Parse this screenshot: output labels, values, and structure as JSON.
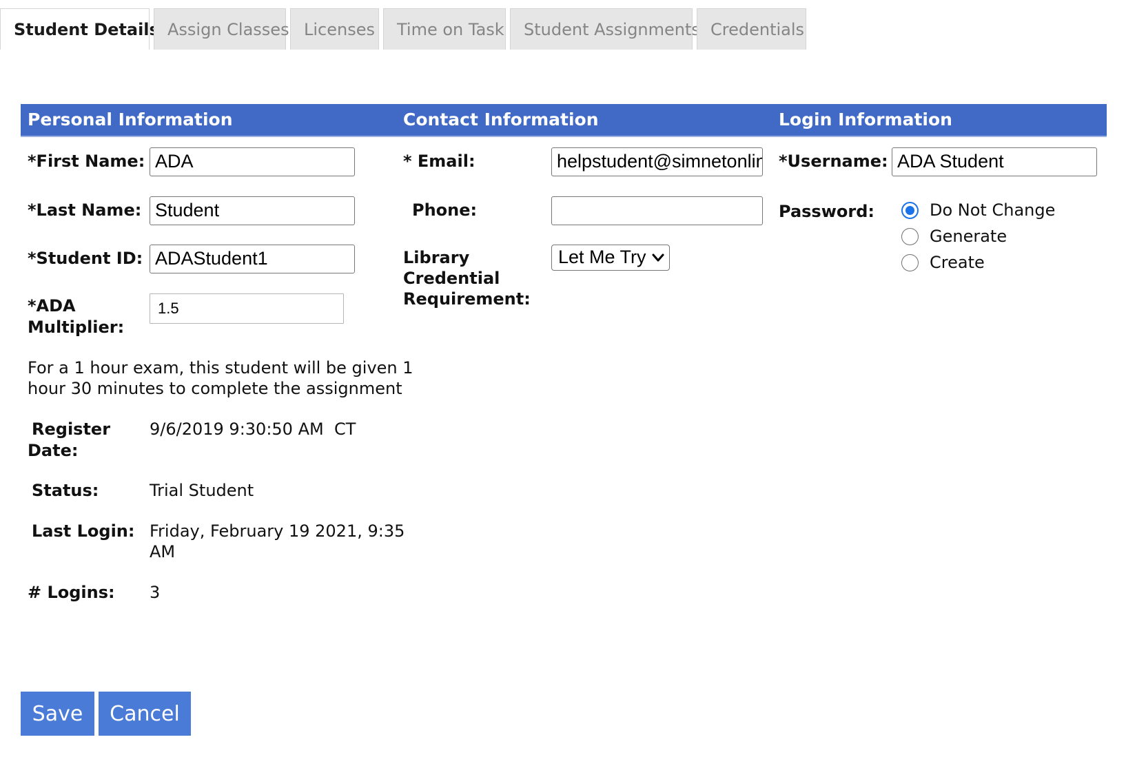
{
  "tabs": [
    "Student Details",
    "Assign Classes",
    "Licenses",
    "Time on Task",
    "Student Assignments",
    "Credentials"
  ],
  "sections": {
    "personal": "Personal Information",
    "contact": "Contact Information",
    "login": "Login Information"
  },
  "personal": {
    "first_name_label": "*First Name:",
    "first_name": "ADA",
    "last_name_label": "*Last Name:",
    "last_name": "Student",
    "student_id_label": "*Student ID:",
    "student_id": "ADAStudent1",
    "ada_label_1": "*ADA",
    "ada_label_2": "Multiplier:",
    "ada_multiplier": "1.5",
    "note_line1": "For a 1 hour exam, this student will be given 1",
    "note_line2": "hour 30 minutes to complete the assignment",
    "register_label_1": "Register",
    "register_label_2": "Date:",
    "register_date": "9/6/2019 9:30:50 AM  CT",
    "status_label": "Status:",
    "status": "Trial Student",
    "last_login_label": "Last Login:",
    "last_login_line1": "Friday, February 19 2021, 9:35",
    "last_login_line2": "AM",
    "logins_label": "# Logins:",
    "logins": "3"
  },
  "contact": {
    "email_label": "* Email:",
    "email": "helpstudent@simnetonline",
    "phone_label": "Phone:",
    "phone": "",
    "library_label_1": "Library",
    "library_label_2": "Credential",
    "library_label_3": "Requirement:",
    "library_value": "Let Me Try"
  },
  "login": {
    "username_label": "*Username:",
    "username": "ADA Student",
    "password_label": "Password:",
    "password_options": [
      "Do Not Change",
      "Generate",
      "Create"
    ],
    "password_selected": "Do Not Change"
  },
  "actions": {
    "save": "Save",
    "cancel": "Cancel"
  },
  "colors": {
    "header_band": "#4169c6",
    "button": "#4a7bd6",
    "radio_selected": "#1a73e8"
  }
}
